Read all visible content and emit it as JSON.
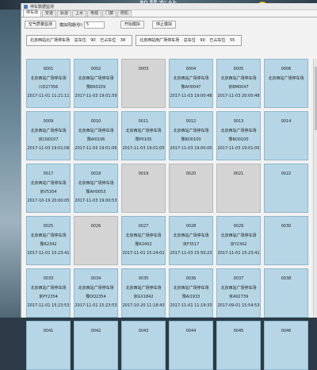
{
  "scene": {
    "banner_title": "智慧车站"
  },
  "window": {
    "title": "停车数据监测",
    "tabs": [
      "停车场",
      "安道",
      "轨道",
      "上水",
      "电视",
      "门禁",
      "照机"
    ],
    "controls": {
      "air_button": "空气质量监测",
      "interval_label": "模拟周期(秒)",
      "interval_value": "5",
      "start_button": "开始模拟",
      "stop_button": "停止模拟"
    },
    "summary": [
      {
        "lot": "北京西站北广场停车场",
        "total_label": "总车位",
        "total": "90",
        "used_label": "已占车位",
        "used": "38"
      },
      {
        "lot": "北京西站南广场停车场",
        "total_label": "总车位",
        "total": "90",
        "used_label": "已占车位",
        "used": "55"
      }
    ]
  },
  "spots": [
    {
      "num": "0001",
      "lot": "北京西站广场停车场",
      "plate": "川D27356",
      "time": "2017-11-01 11:21:11",
      "status": "occupied"
    },
    {
      "num": "0002",
      "lot": "北京西站广场停车场",
      "plate": "豫B90159",
      "time": "2017-11-03 19:01:59",
      "status": "occupied"
    },
    {
      "num": "0003",
      "lot": "",
      "plate": "",
      "time": "",
      "status": "empty"
    },
    {
      "num": "0004",
      "lot": "北京西站广场停车场",
      "plate": "豫AH0047",
      "time": "2017-11-03 19:00:48",
      "status": "occupied"
    },
    {
      "num": "0005",
      "lot": "北京西站广场停车场",
      "plate": "京BM0047",
      "time": "2017-11-03 20:00:48",
      "status": "occupied"
    },
    {
      "num": "0006",
      "lot": "北京西站广场停车场",
      "plate": "",
      "time": "",
      "status": "occupied"
    },
    {
      "num": "0009",
      "lot": "北京西站广场停车场",
      "plate": "京CN0107",
      "time": "2017-11-03 19:01:08",
      "status": "occupied"
    },
    {
      "num": "0010",
      "lot": "北京西站广场停车场",
      "plate": "豫AI0106",
      "time": "2017-11-03 19:01:06",
      "status": "occupied"
    },
    {
      "num": "0011",
      "lot": "北京西站广场停车场",
      "plate": "豫P0105",
      "time": "2017-11-03 19:01:05",
      "status": "occupied"
    },
    {
      "num": "0012",
      "lot": "北京西站广场停车场",
      "plate": "豫RD0100",
      "time": "2017-11-03 19:00:00",
      "status": "occupied"
    },
    {
      "num": "0013",
      "lot": "北京西站广场停车场",
      "plate": "豫RD0100",
      "time": "2017-11-03 19:01:00",
      "status": "occupied"
    },
    {
      "num": "0014",
      "lot": "",
      "plate": "",
      "time": "",
      "status": "occupied"
    },
    {
      "num": "0017",
      "lot": "北京西站广场停车场",
      "plate": "京V5304",
      "time": "2017-10-19 20:00:05",
      "status": "occupied"
    },
    {
      "num": "0018",
      "lot": "北京西站广场停车场",
      "plate": "豫AH0053",
      "time": "2017-11-03 19:00:53",
      "status": "occupied"
    },
    {
      "num": "0019",
      "lot": "",
      "plate": "",
      "time": "",
      "status": "empty"
    },
    {
      "num": "0020",
      "lot": "",
      "plate": "",
      "time": "",
      "status": "empty"
    },
    {
      "num": "0021",
      "lot": "",
      "plate": "",
      "time": "",
      "status": "empty"
    },
    {
      "num": "0022",
      "lot": "",
      "plate": "",
      "time": "",
      "status": "occupied"
    },
    {
      "num": "0025",
      "lot": "北京西站广场停车场",
      "plate": "豫R2342",
      "time": "2017-11-01 15:23:41",
      "status": "occupied"
    },
    {
      "num": "0026",
      "lot": "",
      "plate": "",
      "time": "",
      "status": "empty"
    },
    {
      "num": "0027",
      "lot": "北京西站广场停车场",
      "plate": "豫R2402",
      "time": "2017-11-01 15:24:01",
      "status": "occupied"
    },
    {
      "num": "0028",
      "lot": "北京西站广场停车场",
      "plate": "京F3517",
      "time": "2017-11-03 15:50:23",
      "status": "occupied"
    },
    {
      "num": "0029",
      "lot": "北京西站广场停车场",
      "plate": "京Y2342",
      "time": "2017-11-01 15:23:41",
      "status": "occupied"
    },
    {
      "num": "0030",
      "lot": "",
      "plate": "",
      "time": "",
      "status": "occupied"
    },
    {
      "num": "0033",
      "lot": "北京西站广场停车场",
      "plate": "京PY2354",
      "time": "2017-11-01 15:23:53",
      "status": "occupied"
    },
    {
      "num": "0034",
      "lot": "北京西站广场停车场",
      "plate": "豫DQ2354",
      "time": "2017-11-01 15:23:53",
      "status": "occupied"
    },
    {
      "num": "0035",
      "lot": "北京西站广场停车场",
      "plate": "京GX1842",
      "time": "2017-10-20 11:18:43",
      "status": "occupied"
    },
    {
      "num": "0036",
      "lot": "北京西站广场停车场",
      "plate": "豫AI1933",
      "time": "2017-11-01 11:19:33",
      "status": "occupied"
    },
    {
      "num": "0037",
      "lot": "北京西站广场停车场",
      "plate": "京A92739",
      "time": "2017-09-01 15:54:53",
      "status": "occupied"
    },
    {
      "num": "0038",
      "lot": "",
      "plate": "",
      "time": "",
      "status": "occupied"
    },
    {
      "num": "0041",
      "lot": "",
      "plate": "",
      "time": "",
      "status": "occupied"
    },
    {
      "num": "0042",
      "lot": "",
      "plate": "",
      "time": "",
      "status": "occupied"
    },
    {
      "num": "0043",
      "lot": "",
      "plate": "",
      "time": "",
      "status": "occupied"
    },
    {
      "num": "0044",
      "lot": "",
      "plate": "",
      "time": "",
      "status": "occupied"
    },
    {
      "num": "0045",
      "lot": "",
      "plate": "",
      "time": "",
      "status": "occupied"
    },
    {
      "num": "0046",
      "lot": "",
      "plate": "",
      "time": "",
      "status": "occupied"
    }
  ]
}
